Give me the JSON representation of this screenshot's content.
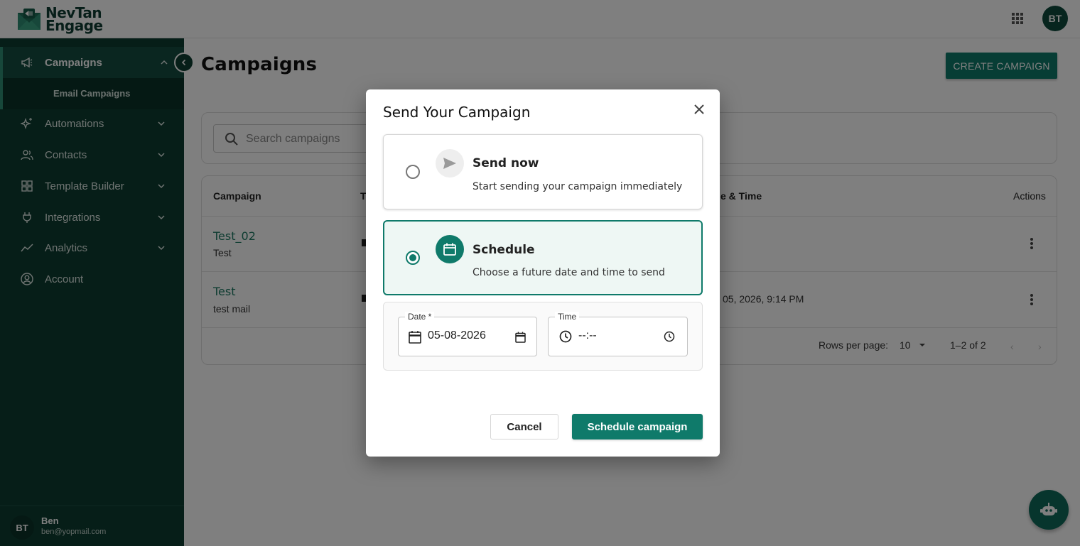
{
  "brand": {
    "name_line1": "NevTan",
    "name_line2": "Engage"
  },
  "header": {
    "avatar_initials": "BT"
  },
  "sidebar": {
    "items": [
      {
        "label": "Campaigns",
        "icon": "megaphone-icon",
        "active": true
      },
      {
        "label": "Automations",
        "icon": "sparkle-icon"
      },
      {
        "label": "Contacts",
        "icon": "people-icon"
      },
      {
        "label": "Template Builder",
        "icon": "grid-icon"
      },
      {
        "label": "Integrations",
        "icon": "plug-icon"
      },
      {
        "label": "Analytics",
        "icon": "trend-icon"
      },
      {
        "label": "Account",
        "icon": "user-circle-icon"
      }
    ],
    "sub_item": "Email Campaigns",
    "user": {
      "initials": "BT",
      "name": "Ben",
      "email": "ben@yopmail.com"
    }
  },
  "main": {
    "title": "Campaigns",
    "create_button": "CREATE CAMPAIGN",
    "search_placeholder": "Search campaigns",
    "table": {
      "headers": {
        "campaign": "Campaign",
        "type_partial": "T",
        "date_partial": "e & Time",
        "actions": "Actions"
      },
      "rows": [
        {
          "name": "Test_02",
          "subject": "Test",
          "date": ""
        },
        {
          "name": "Test",
          "subject": "test mail",
          "date": "05, 2026, 9:14 PM"
        }
      ],
      "pagination": {
        "rows_label": "Rows per page:",
        "rows_value": "10",
        "range": "1–2 of 2"
      }
    }
  },
  "dialog": {
    "title": "Send Your Campaign",
    "options": [
      {
        "title": "Send now",
        "desc": "Start sending your campaign immediately",
        "selected": false
      },
      {
        "title": "Schedule",
        "desc": "Choose a future date and time to send",
        "selected": true
      }
    ],
    "date": {
      "label": "Date *",
      "value": "05-08-2026"
    },
    "time": {
      "label": "Time",
      "value": "--:--"
    },
    "cancel": "Cancel",
    "submit": "Schedule campaign"
  },
  "colors": {
    "accent": "#0f7a6a",
    "sidebar": "#0c3d31"
  }
}
